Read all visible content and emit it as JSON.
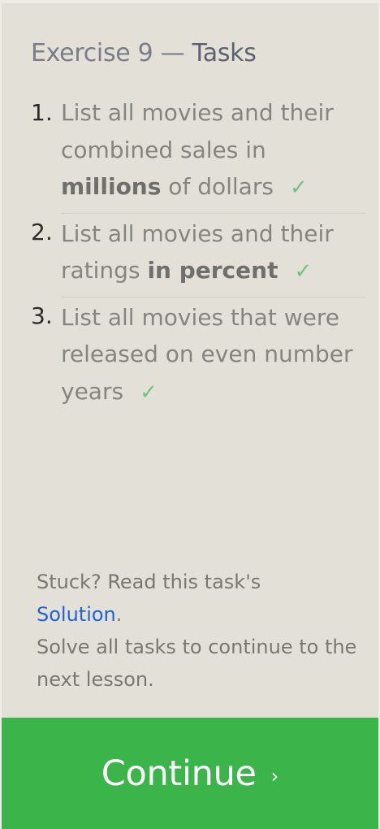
{
  "header": {
    "exercise": "Exercise 9",
    "separator": "—",
    "section": "Tasks"
  },
  "tasks": [
    {
      "number": "1.",
      "text_a": "List all movies and their combined sales in ",
      "bold": "millions",
      "text_b": " of dollars",
      "check": "✓"
    },
    {
      "number": "2.",
      "text_a": "List all movies and their ratings ",
      "bold": "in percent",
      "text_b": "",
      "check": "✓"
    },
    {
      "number": "3.",
      "text_a": "List all movies that were released on even number years",
      "bold": "",
      "text_b": "",
      "check": "✓"
    }
  ],
  "help": {
    "stuck": "Stuck? Read this task's",
    "solution_link": "Solution",
    "period": ".",
    "continue_note": "Solve all tasks to continue to the next lesson."
  },
  "footer": {
    "continue_label": "Continue",
    "continue_arrow": "›"
  },
  "colors": {
    "panel_bg": "#e3e1d7",
    "check": "#72c083",
    "link": "#1f63d6",
    "continue_bg": "#3bb54a"
  }
}
